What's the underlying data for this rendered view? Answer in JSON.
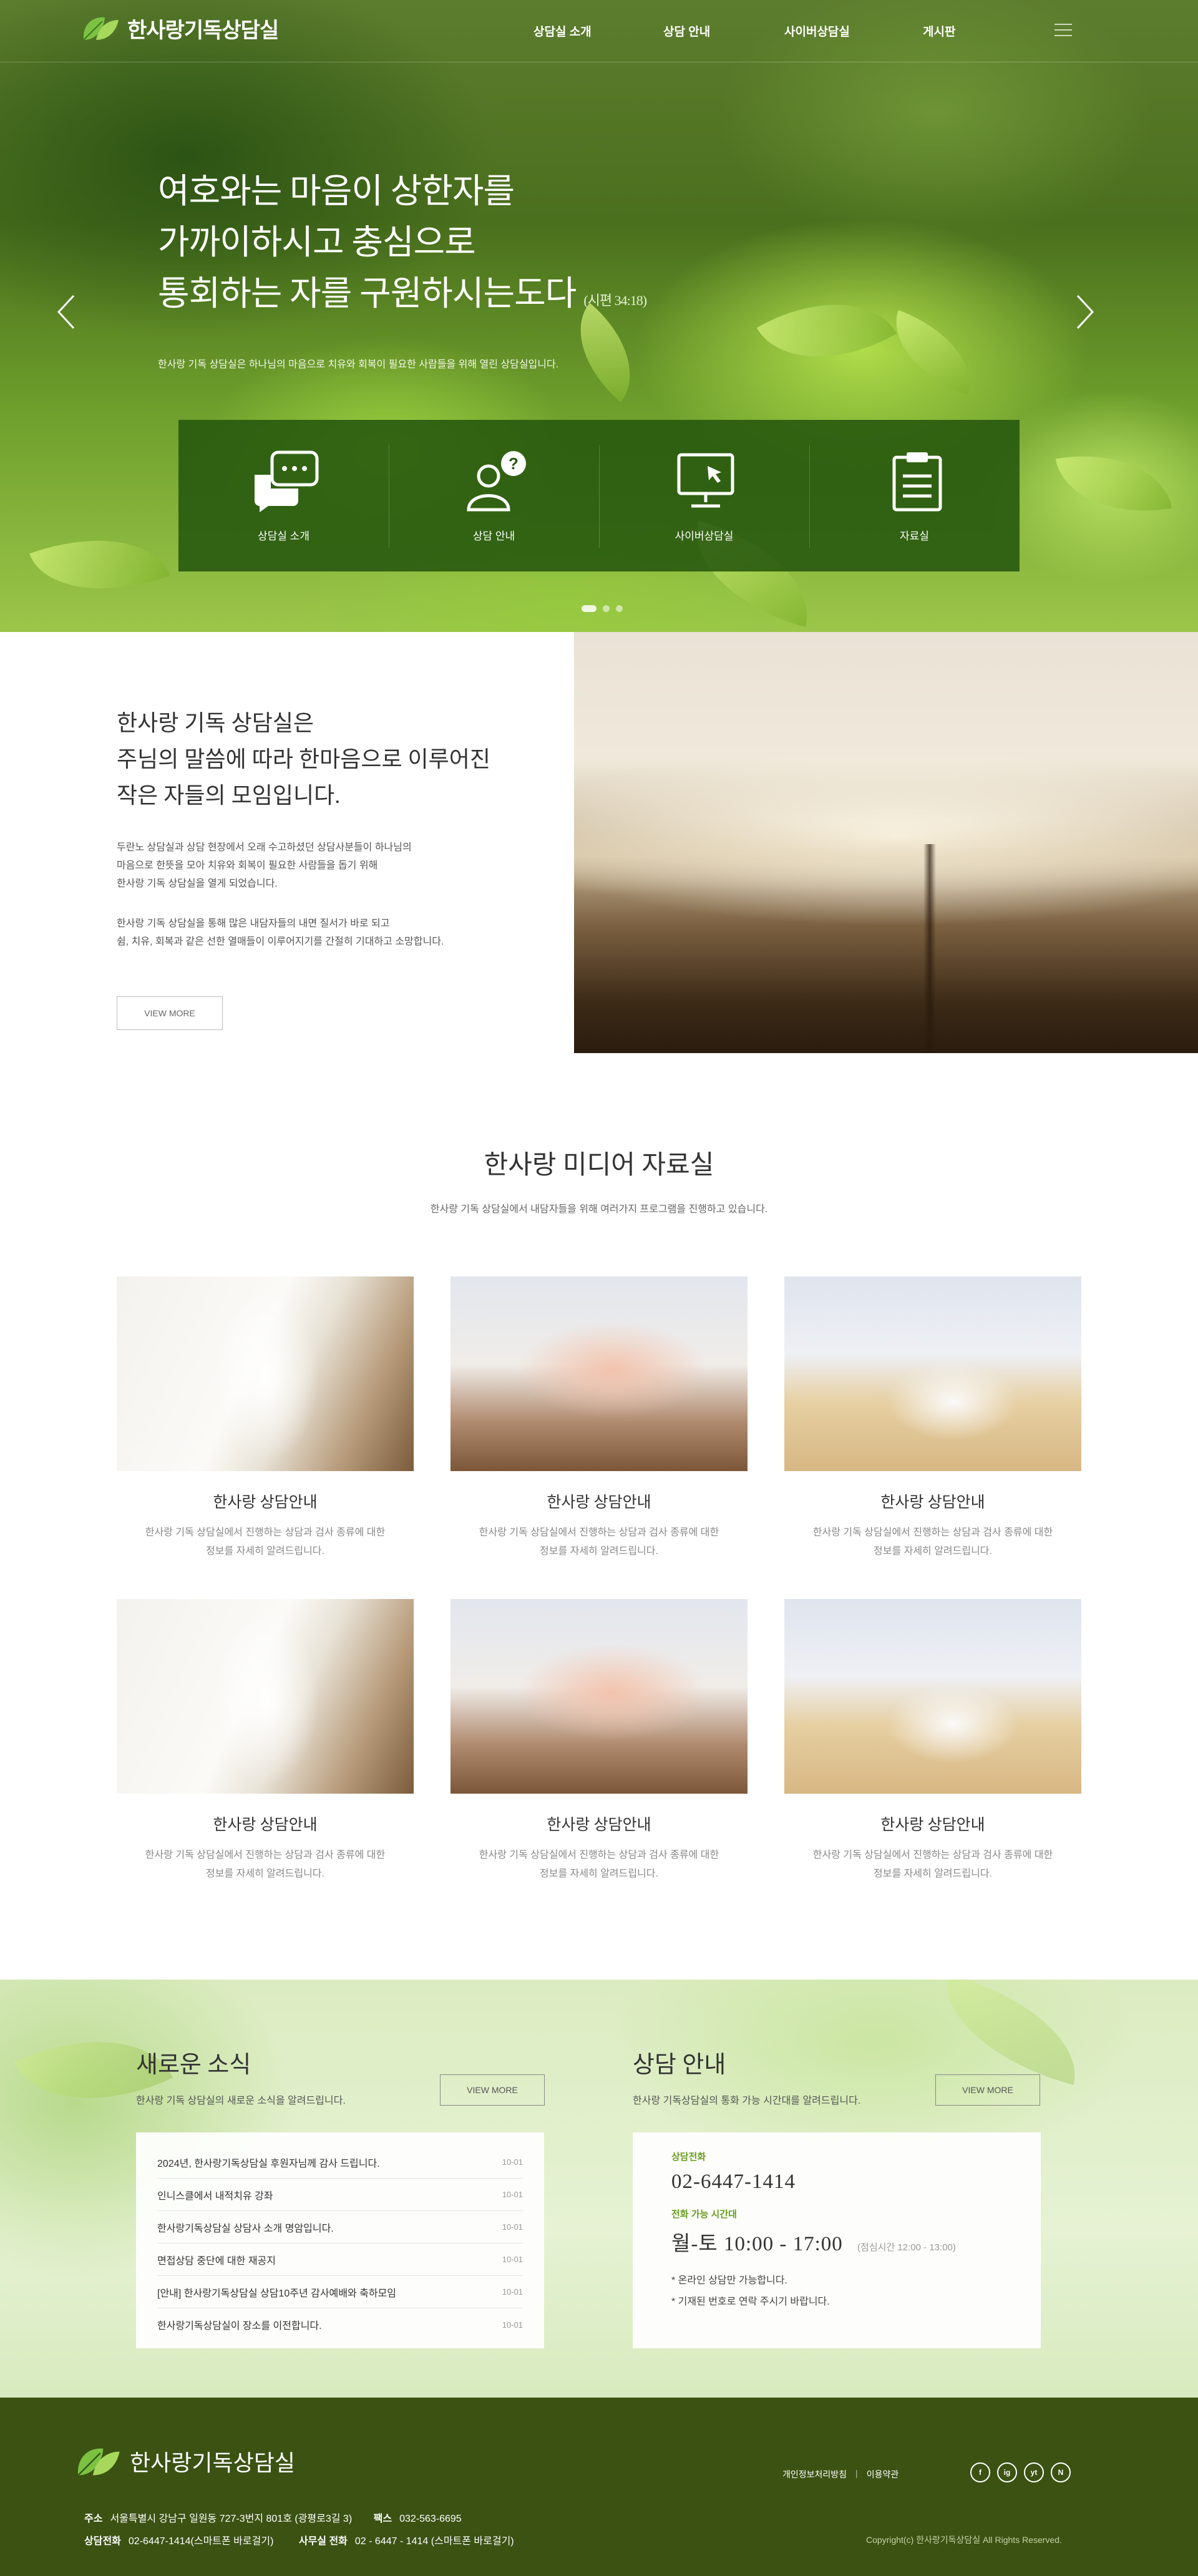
{
  "header": {
    "logo_text": "한사랑기독상담실",
    "nav": [
      "상담실 소개",
      "상담 안내",
      "사이버상담실",
      "게시판"
    ]
  },
  "hero": {
    "title_line1": "여호와는 마음이 상한자를",
    "title_line2": "가까이하시고 충심으로",
    "title_line3": "통회하는 자를 구원하시는도다",
    "reference": "(시편 34:18)",
    "subtitle": "한사랑 기독 상담실은 하나님의 마음으로 치유와 회복이 필요한 사람들을 위해 열린 상담실입니다.",
    "quick_links": [
      {
        "label": "상담실 소개",
        "icon": "chat-bubbles-icon"
      },
      {
        "label": "상담 안내",
        "icon": "person-question-icon"
      },
      {
        "label": "사이버상담실",
        "icon": "monitor-cursor-icon"
      },
      {
        "label": "자료실",
        "icon": "clipboard-icon"
      }
    ],
    "active_slide": 1,
    "slide_count": 3
  },
  "intro": {
    "title_line1": "한사랑 기독 상담실은",
    "title_line2": "주님의 말씀에 따라 한마음으로 이루어진",
    "title_line3": "작은 자들의 모임입니다.",
    "para1_line1": "두란노 상담실과 상담 현장에서 오래 수고하셨던 상담사분들이 하나님의",
    "para1_line2": "마음으로 한뜻을 모아 치유와 회복이 필요한 사람들을 돕기 위해",
    "para1_line3": "한사랑 기독 상담실을 열게 되었습니다.",
    "para2_line1": "한사랑 기독 상담실을 통해 많은 내담자들의 내면 질서가 바로 되고",
    "para2_line2": "쉼, 치유, 회복과 같은 선한 열매들이 이루어지기를 간절히 기대하고 소망합니다.",
    "more_label": "VIEW MORE"
  },
  "media": {
    "title": "한사랑 미디어 자료실",
    "subtitle": "한사랑 기독 상담실에서 내담자들을 위해 여러가지 프로그램을 진행하고 있습니다.",
    "cards": [
      {
        "title": "한사랑 상담안내",
        "desc1": "한사랑 기독 상담실에서 진행하는 상담과 검사 종류에 대한",
        "desc2": "정보를 자세히 알려드립니다."
      },
      {
        "title": "한사랑 상담안내",
        "desc1": "한사랑 기독 상담실에서 진행하는 상담과 검사 종류에 대한",
        "desc2": "정보를 자세히 알려드립니다."
      },
      {
        "title": "한사랑 상담안내",
        "desc1": "한사랑 기독 상담실에서 진행하는 상담과 검사 종류에 대한",
        "desc2": "정보를 자세히 알려드립니다."
      },
      {
        "title": "한사랑 상담안내",
        "desc1": "한사랑 기독 상담실에서 진행하는 상담과 검사 종류에 대한",
        "desc2": "정보를 자세히 알려드립니다."
      },
      {
        "title": "한사랑 상담안내",
        "desc1": "한사랑 기독 상담실에서 진행하는 상담과 검사 종류에 대한",
        "desc2": "정보를 자세히 알려드립니다."
      },
      {
        "title": "한사랑 상담안내",
        "desc1": "한사랑 기독 상담실에서 진행하는 상담과 검사 종류에 대한",
        "desc2": "정보를 자세히 알려드립니다."
      }
    ]
  },
  "news": {
    "title": "새로운 소식",
    "subtitle": "한사랑 기독 상담실의 새로운 소식을 알려드립니다.",
    "more_label": "VIEW MORE",
    "items": [
      {
        "text": "2024년, 한사랑기독상담실 후원자님께 감사 드립니다.",
        "date": "10-01"
      },
      {
        "text": "인니스클에서 내적치유 강좌",
        "date": "10-01"
      },
      {
        "text": "한사랑기독상담실 상담사 소개 명암입니다.",
        "date": "10-01"
      },
      {
        "text": "면접상담 중단에 대한 재공지",
        "date": "10-01"
      },
      {
        "text": "[안내] 한사랑기독상담실 상담10주년 감사예배와 축하모임",
        "date": "10-01"
      },
      {
        "text": "한사랑기독상담실이 장소를 이전합니다.",
        "date": "10-01"
      }
    ]
  },
  "consult": {
    "title": "상담 안내",
    "subtitle": "한사랑 기독상담실의 통화 가능 시간대를 알려드립니다.",
    "more_label": "VIEW MORE",
    "phone_label": "상담전화",
    "phone": "02-6447-1414",
    "hours_label": "전화 가능 시간대",
    "hours": "월-토 10:00 - 17:00",
    "lunch": "(점심시간 12:00 - 13:00)",
    "note1": "* 온라인 상담만 가능합니다.",
    "note2": "* 기재된 번호로 연락 주시기 바랍니다."
  },
  "footer": {
    "logo_text": "한사랑기독상담실",
    "link_privacy": "개인정보처리방침",
    "link_terms": "이용약관",
    "social": [
      "f",
      "ig",
      "yt",
      "N"
    ],
    "addr_label": "주소",
    "addr": "서울특별시 강남구 일원동 727-3번지 801호 (광평로3길 3)",
    "fax_label": "팩스",
    "fax": "032-563-6695",
    "phone_label": "상담전화",
    "phone": "02-6447-1414(스마트폰 바로걸기)",
    "office_label": "사무실 전화",
    "office": "02 - 6447 - 1414 (스마트폰 바로걸기)",
    "copyright": "Copyright(c) 한사랑기독상담실 All Rights Reserved."
  },
  "colors": {
    "accent_green": "#6a9d1f",
    "footer_bg": "#3b5213",
    "quick_bg": "#25560e"
  }
}
